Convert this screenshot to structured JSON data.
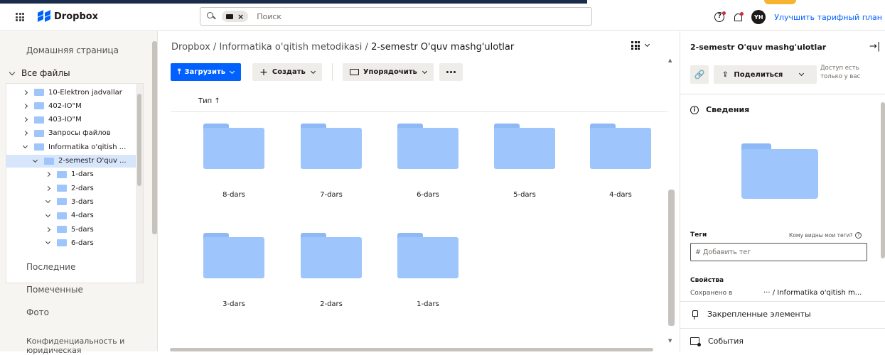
{
  "header": {
    "brand": "Dropbox",
    "search_placeholder": "Поиск",
    "search_chip_close": "×",
    "help_glyph": "?",
    "avatar_initials": "YH",
    "upgrade_label": "Улучшить тарифный план"
  },
  "sidebar": {
    "home": "Домашняя страница",
    "all_files": "Все файлы",
    "tree": [
      {
        "label": "10-Elektron jadvallar",
        "expanded": false,
        "level": 0
      },
      {
        "label": "402-IO\"M",
        "expanded": false,
        "level": 0
      },
      {
        "label": "403-IO\"M",
        "expanded": false,
        "level": 0
      },
      {
        "label": "Запросы файлов",
        "expanded": false,
        "level": 0
      },
      {
        "label": "Informatika o'qitish ...",
        "expanded": true,
        "level": 0
      },
      {
        "label": "2-semestr O'quv ...",
        "expanded": true,
        "level": 1,
        "selected": true
      },
      {
        "label": "1-dars",
        "expanded": false,
        "level": 2
      },
      {
        "label": "2-dars",
        "expanded": false,
        "level": 2
      },
      {
        "label": "3-dars",
        "expanded": true,
        "level": 2
      },
      {
        "label": "4-dars",
        "expanded": true,
        "level": 2
      },
      {
        "label": "5-dars",
        "expanded": false,
        "level": 2
      },
      {
        "label": "6-dars",
        "expanded": true,
        "level": 2
      }
    ],
    "recent": "Последние",
    "starred": "Помеченные",
    "photos": "Фото",
    "privacy": "Конфиденциальность и юридическая"
  },
  "main": {
    "breadcrumb_root": "Dropbox",
    "breadcrumb_sep1": "/",
    "breadcrumb_mid": "Informatika o'qitish metodikasi",
    "breadcrumb_sep2": "/",
    "breadcrumb_current": "2-semestr O'quv mashg'ulotlar",
    "upload_label": "Загрузить",
    "create_label": "Создать",
    "organize_label": "Упорядочить",
    "col_type": "Тип ↑",
    "folders": [
      "8-dars",
      "7-dars",
      "6-dars",
      "5-dars",
      "4-dars",
      "3-dars",
      "2-dars",
      "1-dars"
    ]
  },
  "panel": {
    "title": "2-semestr O'quv mashg'ulotlar",
    "collapse_glyph": "→|",
    "link_glyph": "🔗",
    "share_label": "Поделиться",
    "access_line1": "Доступ есть",
    "access_line2": "только у вас",
    "info_label": "Сведения",
    "tags_label": "Теги",
    "who_sees_tags": "Кому видны мои теги?",
    "add_tag_placeholder": "# Добавить тег",
    "properties_label": "Свойства",
    "saved_in_label": "Сохранено в",
    "saved_in_path": "··· / Informatika o'qitish m...",
    "pinned_label": "Закрепленные элементы",
    "events_label": "События"
  },
  "colors": {
    "accent": "#0061fe",
    "folder": "#9ec5fc",
    "selected_row": "#d8e6fb",
    "notification_dot": "#d42d3a"
  }
}
